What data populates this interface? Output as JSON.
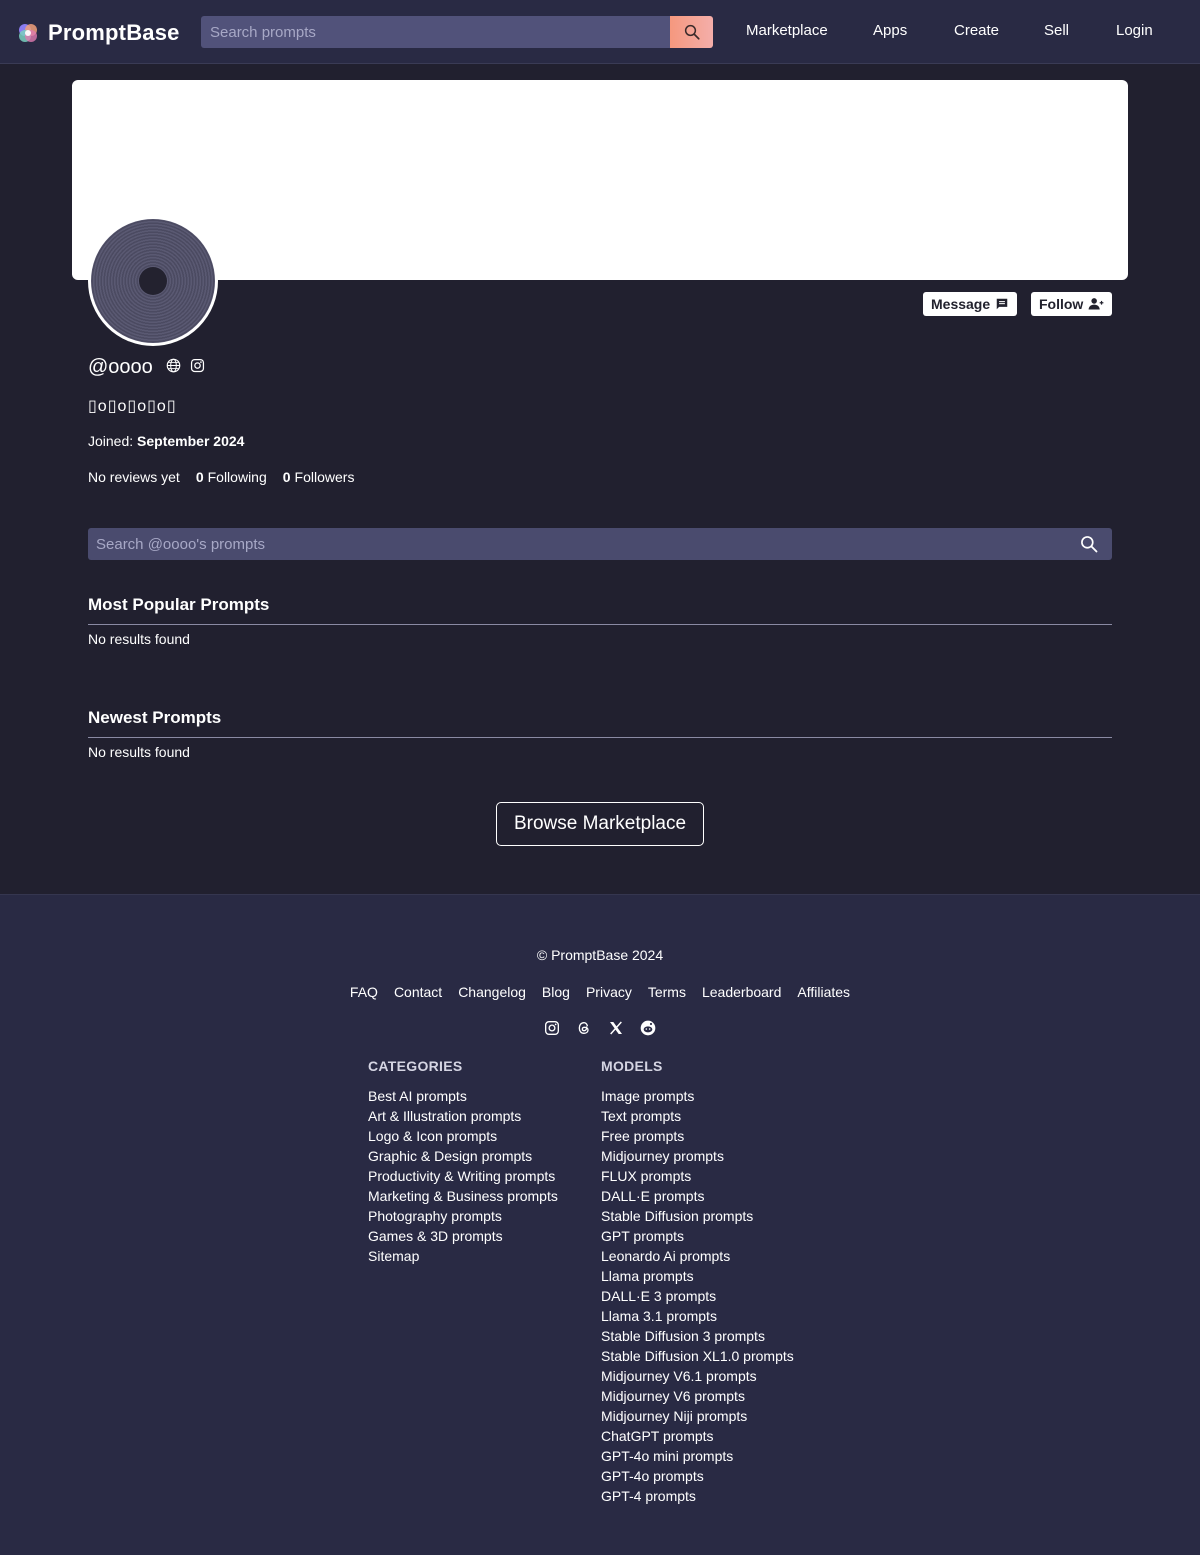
{
  "header": {
    "logo_text": "PromptBase",
    "search_placeholder": "Search prompts",
    "nav": [
      {
        "label": "Marketplace"
      },
      {
        "label": "Apps"
      },
      {
        "label": "Create"
      },
      {
        "label": "Sell"
      },
      {
        "label": "Login"
      }
    ]
  },
  "profile": {
    "username": "@oooo",
    "bio": "▯o▯o▯o▯o▯",
    "joined_label": "Joined:",
    "joined_value": "September 2024",
    "reviews": "No reviews yet",
    "following_count": "0",
    "following_label": "Following",
    "followers_count": "0",
    "followers_label": "Followers",
    "message_label": "Message",
    "follow_label": "Follow",
    "search_placeholder": "Search @oooo's prompts"
  },
  "sections": {
    "popular_title": "Most Popular Prompts",
    "popular_empty": "No results found",
    "newest_title": "Newest Prompts",
    "newest_empty": "No results found"
  },
  "browse_label": "Browse Marketplace",
  "footer": {
    "copyright": "© PromptBase 2024",
    "links": [
      "FAQ",
      "Contact",
      "Changelog",
      "Blog",
      "Privacy",
      "Terms",
      "Leaderboard",
      "Affiliates"
    ],
    "socials": [
      "instagram-icon",
      "threads-icon",
      "x-icon",
      "reddit-icon"
    ],
    "categories_title": "CATEGORIES",
    "categories": [
      "Best AI prompts",
      "Art & Illustration prompts",
      "Logo & Icon prompts",
      "Graphic & Design prompts",
      "Productivity & Writing prompts",
      "Marketing & Business prompts",
      "Photography prompts",
      "Games & 3D prompts",
      "Sitemap"
    ],
    "models_title": "MODELS",
    "models": [
      "Image prompts",
      "Text prompts",
      "Free prompts",
      "Midjourney prompts",
      "FLUX prompts",
      "DALL·E prompts",
      "Stable Diffusion prompts",
      "GPT prompts",
      "Leonardo Ai prompts",
      "Llama prompts",
      "DALL·E 3 prompts",
      "Llama 3.1 prompts",
      "Stable Diffusion 3 prompts",
      "Stable Diffusion XL1.0 prompts",
      "Midjourney V6.1 prompts",
      "Midjourney V6 prompts",
      "Midjourney Niji prompts",
      "ChatGPT prompts",
      "GPT-4o mini prompts",
      "GPT-4o prompts",
      "GPT-4 prompts"
    ]
  }
}
